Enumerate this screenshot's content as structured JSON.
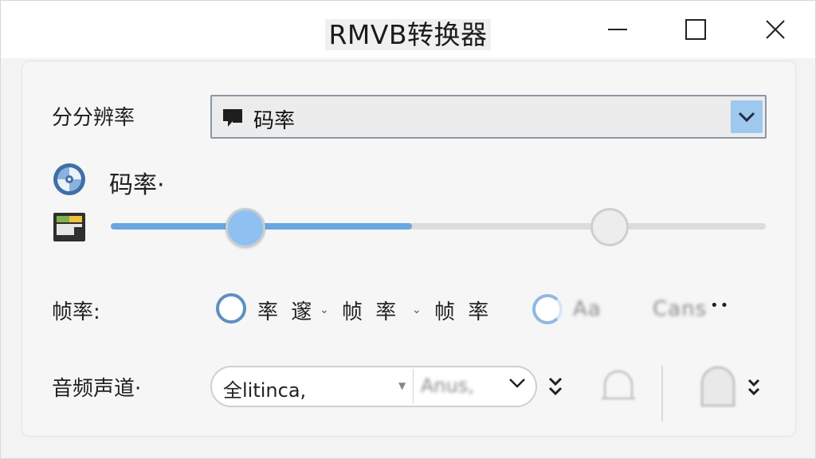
{
  "window": {
    "title": "RMVB转换器",
    "controls": {
      "minimize": "minimize",
      "maximize": "maximize",
      "close": "close"
    }
  },
  "resolution": {
    "label": "分分辨率",
    "dropdown_value": "码率",
    "dropdown_icon": "screen-icon"
  },
  "bitrate": {
    "label": "码率·",
    "icon": "disc-icon",
    "folder_icon": "folder-icon",
    "slider_value_fraction": 0.46,
    "slider_second_fraction": 0.76
  },
  "framerate": {
    "label": "帧率:",
    "options": [
      {
        "text": "率 邃",
        "chev": "⌄"
      },
      {
        "text": "帧 率",
        "chev": "⌄"
      },
      {
        "text": "帧 率",
        "chev": ""
      }
    ],
    "option2_text_a": "Aa",
    "option2_text_b": "Cans",
    "more": "••"
  },
  "audio": {
    "label": "音频声道·",
    "combo_left": "全litinca,",
    "combo_right": "Anus,",
    "expand_glyph": "⌄⌄"
  },
  "colors": {
    "accent": "#6aa6e0",
    "thumb": "#8ec0f1",
    "dropdown_arrow_bg": "#9fc8ee",
    "radio_border": "#5f8fc2"
  }
}
